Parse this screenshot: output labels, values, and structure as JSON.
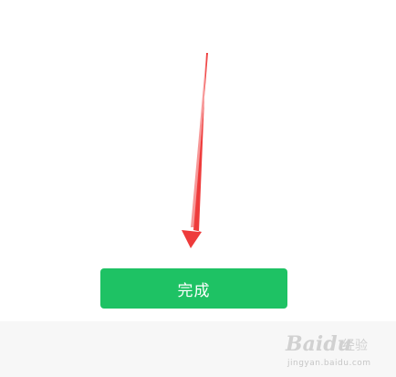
{
  "done_button": {
    "label": "完成"
  },
  "colors": {
    "button_green": "#1ec264",
    "button_text": "#ffffff",
    "arrow_red": "#ee3b3b",
    "background": "#ffffff"
  },
  "annotation": {
    "icon": "red-arrow-icon"
  },
  "watermark": {
    "brand": "Baidu",
    "product": "经验",
    "url": "jingyan.baidu.com"
  }
}
